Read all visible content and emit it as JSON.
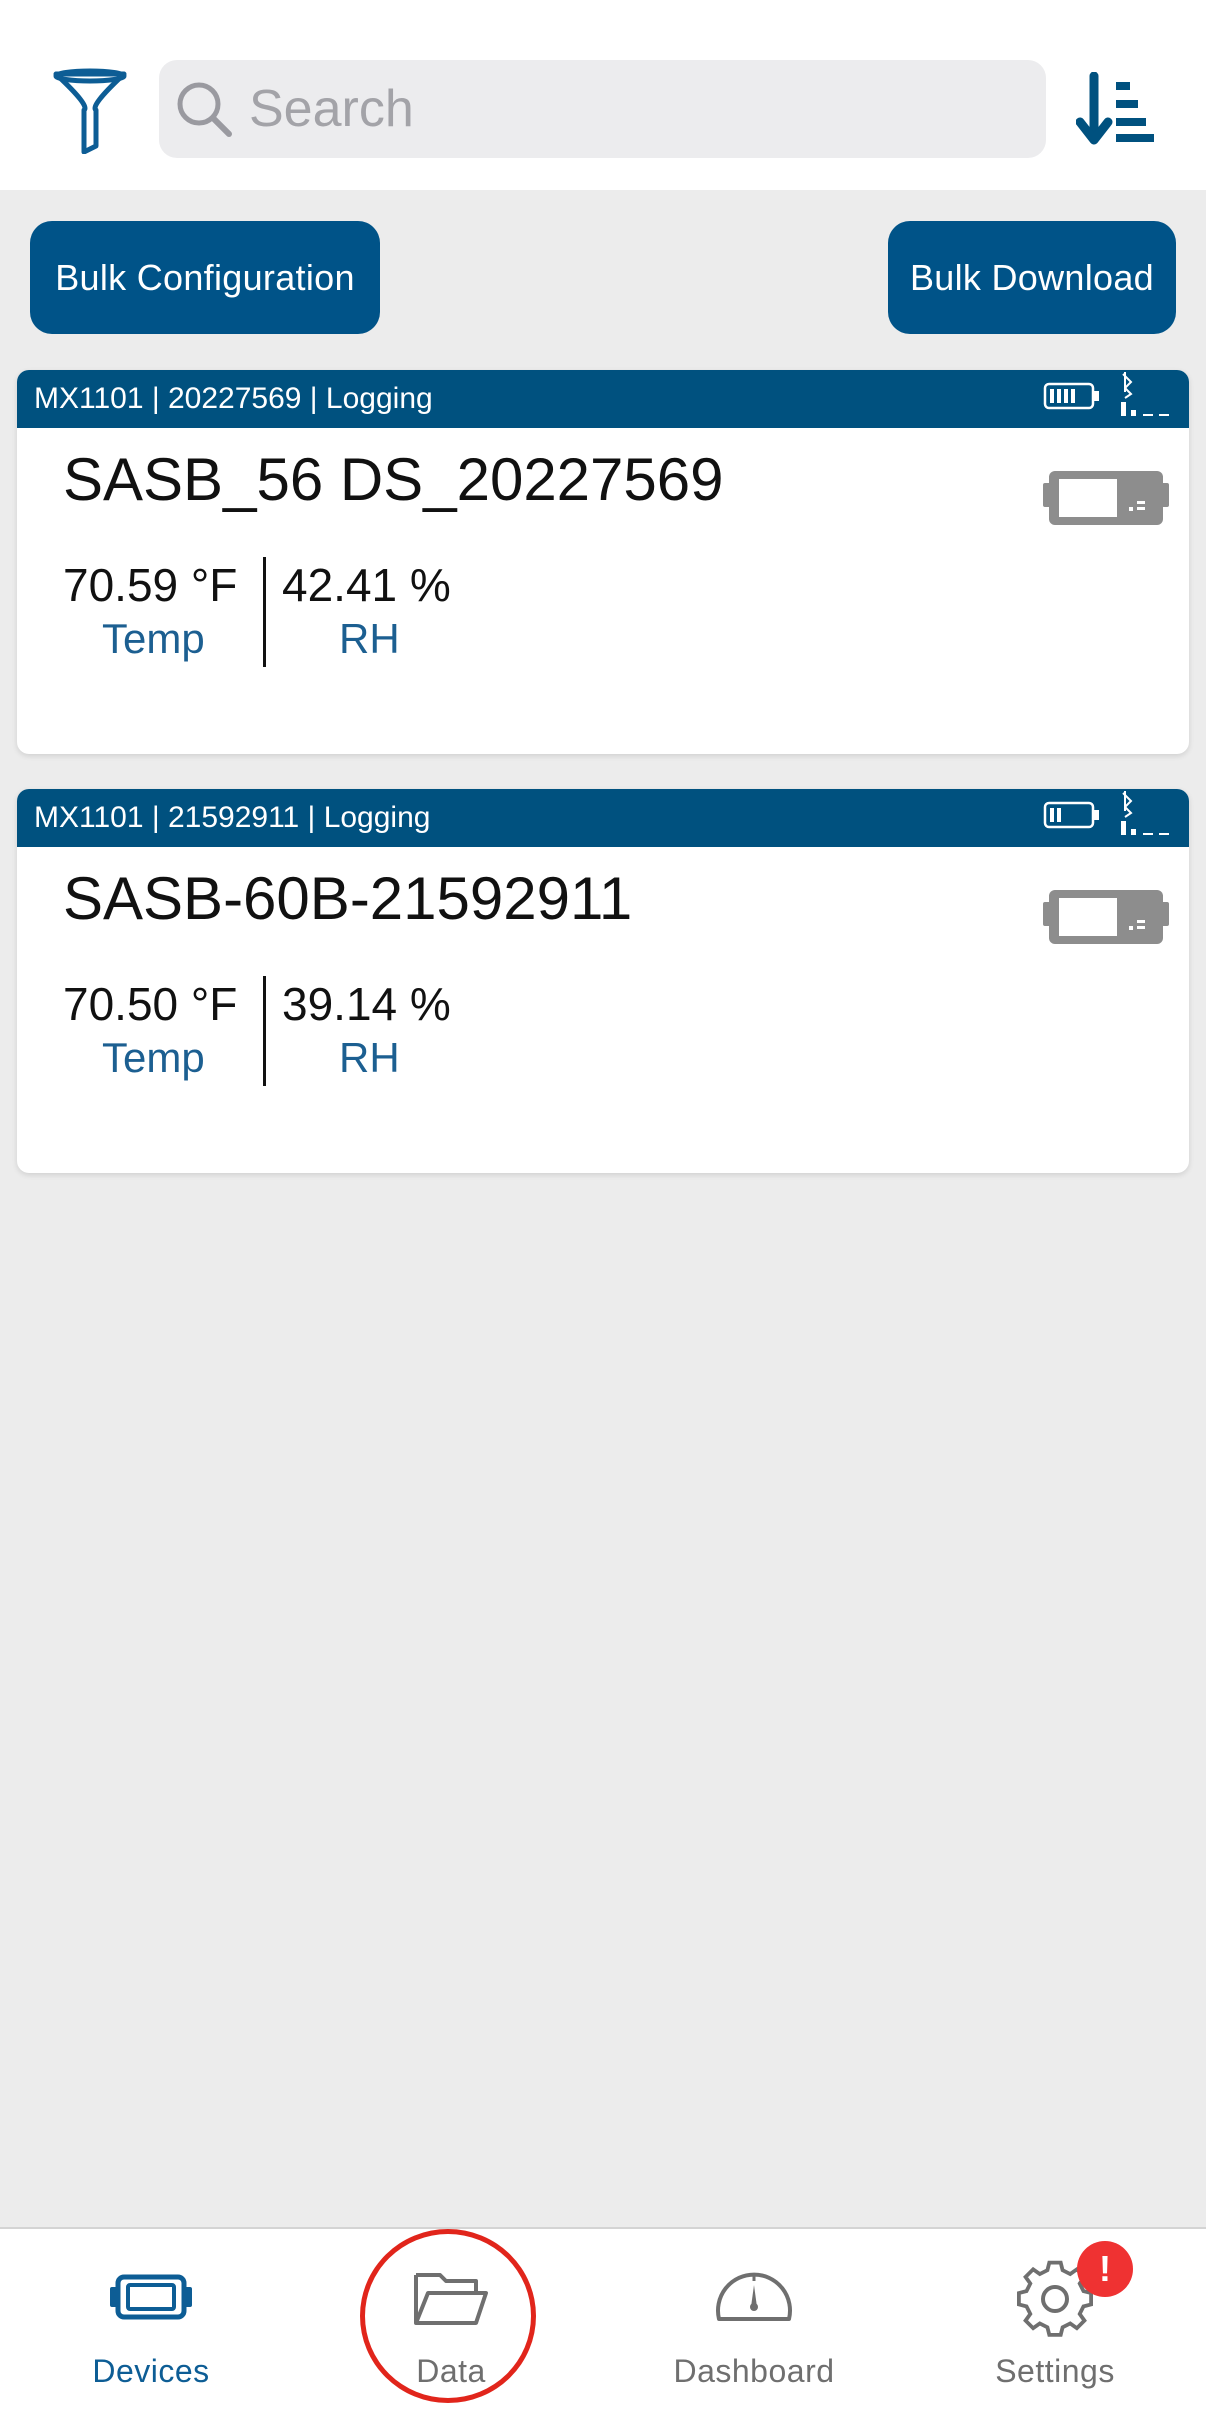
{
  "search": {
    "placeholder": "Search",
    "value": ""
  },
  "toolbar": {
    "bulk_configuration_label": "Bulk Configuration",
    "bulk_download_label": "Bulk Download"
  },
  "devices": [
    {
      "header": "MX1101 | 20227569 | Logging",
      "name": "SASB_56 DS_20227569",
      "temp_value": "70.59 °F",
      "temp_label": "Temp",
      "rh_value": "42.41 %",
      "rh_label": "RH",
      "battery_level": 1.0
    },
    {
      "header": "MX1101 | 21592911 | Logging",
      "name": "SASB-60B-21592911",
      "temp_value": "70.50 °F",
      "temp_label": "Temp",
      "rh_value": "39.14 %",
      "rh_label": "RH",
      "battery_level": 0.4
    }
  ],
  "tabs": [
    {
      "label": "Devices",
      "icon": "logger-icon",
      "active": true
    },
    {
      "label": "Data",
      "icon": "folder-icon",
      "active": false
    },
    {
      "label": "Dashboard",
      "icon": "gauge-icon",
      "active": false
    },
    {
      "label": "Settings",
      "icon": "gear-icon",
      "active": false,
      "badge": "!"
    }
  ],
  "colors": {
    "brand_blue": "#005388",
    "header_blue": "#00517f",
    "label_blue": "#1c5f91",
    "highlight_red": "#e1251b",
    "badge_red": "#ef3232"
  }
}
